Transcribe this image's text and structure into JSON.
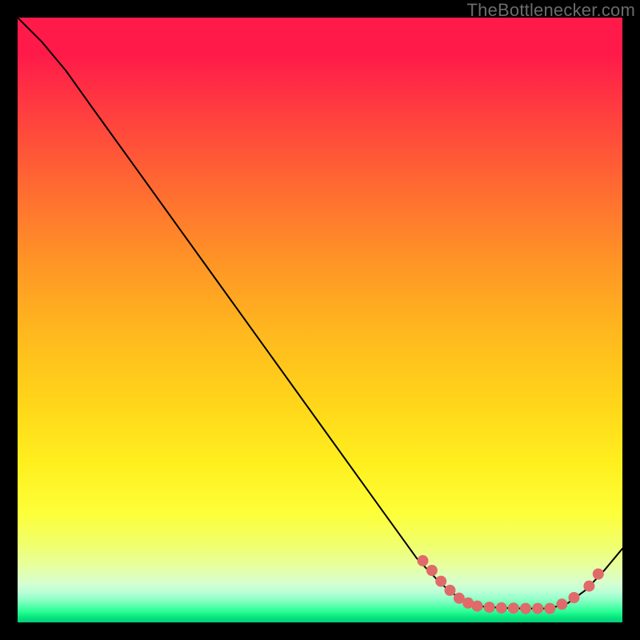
{
  "watermark": "TheBottlenecker.com",
  "chart_data": {
    "type": "line",
    "title": "",
    "xlabel": "",
    "ylabel": "",
    "xlim": [
      0,
      100
    ],
    "ylim": [
      0,
      100
    ],
    "grid": false,
    "legend": false,
    "background_gradient": {
      "stops": [
        {
          "offset": 0.0,
          "color": "#ff1a4a"
        },
        {
          "offset": 0.06,
          "color": "#ff1a49"
        },
        {
          "offset": 0.16,
          "color": "#ff3f3f"
        },
        {
          "offset": 0.28,
          "color": "#ff6a32"
        },
        {
          "offset": 0.4,
          "color": "#ff9326"
        },
        {
          "offset": 0.52,
          "color": "#ffb81e"
        },
        {
          "offset": 0.64,
          "color": "#ffd61a"
        },
        {
          "offset": 0.74,
          "color": "#fff01f"
        },
        {
          "offset": 0.82,
          "color": "#fdff39"
        },
        {
          "offset": 0.87,
          "color": "#f1ff6b"
        },
        {
          "offset": 0.905,
          "color": "#e7ff9d"
        },
        {
          "offset": 0.935,
          "color": "#d7ffcf"
        },
        {
          "offset": 0.95,
          "color": "#b9ffd7"
        },
        {
          "offset": 0.962,
          "color": "#8fffc6"
        },
        {
          "offset": 0.972,
          "color": "#5dffb0"
        },
        {
          "offset": 0.982,
          "color": "#2aff95"
        },
        {
          "offset": 0.992,
          "color": "#06e47e"
        },
        {
          "offset": 1.0,
          "color": "#04cf77"
        }
      ]
    },
    "curve": {
      "description": "Black polyline; y-values estimated from pixels (y=0 bottom, y=100 top).",
      "points": [
        {
          "x": 0.0,
          "y": 100.0
        },
        {
          "x": 4.0,
          "y": 96.0
        },
        {
          "x": 8.0,
          "y": 91.2
        },
        {
          "x": 12.0,
          "y": 85.6
        },
        {
          "x": 20.0,
          "y": 74.5
        },
        {
          "x": 30.0,
          "y": 60.6
        },
        {
          "x": 40.0,
          "y": 46.7
        },
        {
          "x": 50.0,
          "y": 32.8
        },
        {
          "x": 60.0,
          "y": 18.9
        },
        {
          "x": 66.0,
          "y": 10.6
        },
        {
          "x": 70.0,
          "y": 6.4
        },
        {
          "x": 73.0,
          "y": 4.0
        },
        {
          "x": 76.0,
          "y": 2.7
        },
        {
          "x": 80.0,
          "y": 2.4
        },
        {
          "x": 84.0,
          "y": 2.3
        },
        {
          "x": 88.0,
          "y": 2.3
        },
        {
          "x": 91.0,
          "y": 3.2
        },
        {
          "x": 94.0,
          "y": 5.4
        },
        {
          "x": 97.0,
          "y": 8.6
        },
        {
          "x": 100.0,
          "y": 12.2
        }
      ]
    },
    "dots": {
      "color": "#e06a6a",
      "radius": 7,
      "points": [
        {
          "x": 67.0,
          "y": 10.2
        },
        {
          "x": 68.5,
          "y": 8.6
        },
        {
          "x": 70.0,
          "y": 6.8
        },
        {
          "x": 71.5,
          "y": 5.3
        },
        {
          "x": 73.0,
          "y": 4.0
        },
        {
          "x": 74.5,
          "y": 3.2
        },
        {
          "x": 76.0,
          "y": 2.7
        },
        {
          "x": 78.0,
          "y": 2.5
        },
        {
          "x": 80.0,
          "y": 2.4
        },
        {
          "x": 82.0,
          "y": 2.35
        },
        {
          "x": 84.0,
          "y": 2.3
        },
        {
          "x": 86.0,
          "y": 2.3
        },
        {
          "x": 88.0,
          "y": 2.3
        },
        {
          "x": 90.0,
          "y": 3.0
        },
        {
          "x": 92.0,
          "y": 4.1
        },
        {
          "x": 94.5,
          "y": 6.0
        },
        {
          "x": 96.0,
          "y": 8.0
        }
      ]
    }
  }
}
